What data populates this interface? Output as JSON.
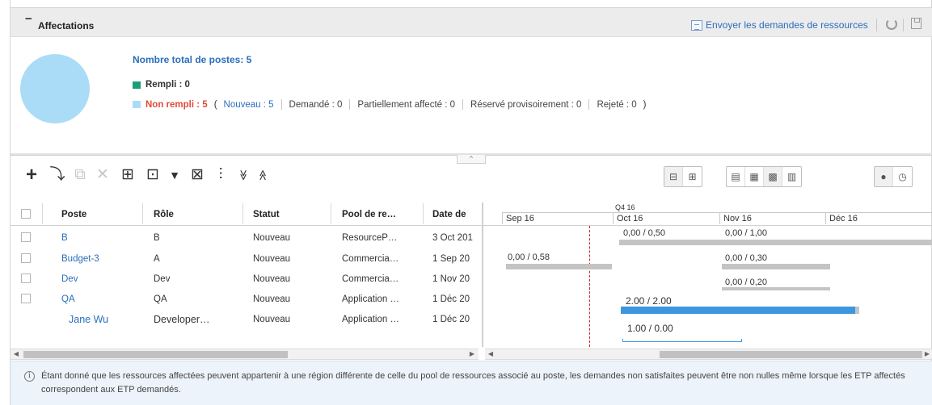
{
  "header": {
    "collapse_symbol": "−",
    "title": "Affectations",
    "send_requests_label": "Envoyer les demandes de ressources"
  },
  "summary": {
    "total_label": "Nombre total de postes: 5",
    "filled_label": "Rempli : 0",
    "unfilled_label": "Non rempli : 5",
    "open_paren": "(",
    "close_paren": ")",
    "new_label": "Nouveau : 5",
    "requested_label": "Demandé : 0",
    "partially_label": "Partiellement affecté : 0",
    "soft_booked_label": "Réservé provisoirement : 0",
    "rejected_label": "Rejeté : 0",
    "colors": {
      "filled": "#1a9e7a",
      "unfilled": "#aadcf8"
    }
  },
  "splitter": {
    "handle_symbol": "^"
  },
  "toolbar": {
    "add_icon": "+",
    "import_icon": "⤵",
    "copy_icon": "⧉",
    "delete_icon": "✕",
    "resource_icon": "⊞",
    "schedule_icon": "⊡",
    "filter_icon": "▼",
    "export_icon": "⊠",
    "chart_icon": "⫶",
    "expand_icon": "≫",
    "collapse_icon": "≪"
  },
  "grid": {
    "columns": [
      "Poste",
      "Rôle",
      "Statut",
      "Pool de re…",
      "Date de"
    ],
    "rows": [
      {
        "poste": "B",
        "role": "B",
        "statut": "Nouveau",
        "pool": "ResourceP…",
        "date": "3 Oct 201"
      },
      {
        "poste": "Budget-3",
        "role": "A",
        "statut": "Nouveau",
        "pool": "Commercia…",
        "date": "1 Sep 20"
      },
      {
        "poste": "Dev",
        "role": "Dev",
        "statut": "Nouveau",
        "pool": "Commercia…",
        "date": "1 Nov 20"
      },
      {
        "poste": "QA",
        "role": "QA",
        "statut": "Nouveau",
        "pool": "Application …",
        "date": "1 Déc 20"
      },
      {
        "poste": "Jane Wu",
        "role": "Developer…",
        "statut": "Nouveau",
        "pool": "Application …",
        "date": "1 Déc 20"
      }
    ]
  },
  "gantt": {
    "quarter": "Q4 16",
    "months": [
      "Sep 16",
      "Oct 16",
      "Nov 16",
      "Déc 16"
    ],
    "labels": {
      "r1a": "0,00 / 0,50",
      "r1b": "0,00 / 1,00",
      "r2a": "0,00 / 0,58",
      "r2b": "0,00 / 0,30",
      "r3a": "0,00 / 0,20",
      "r4a": "2.00 / 2.00",
      "r5a": "1.00 / 0.00"
    }
  },
  "footer": {
    "info_icon": "i",
    "message": "Étant donné que les ressources affectées peuvent appartenir à une région différente de celle du pool de ressources associé au poste, les demandes non satisfaites peuvent être non nulles même lorsque les ETP affectés correspondent aux ETP demandés."
  }
}
